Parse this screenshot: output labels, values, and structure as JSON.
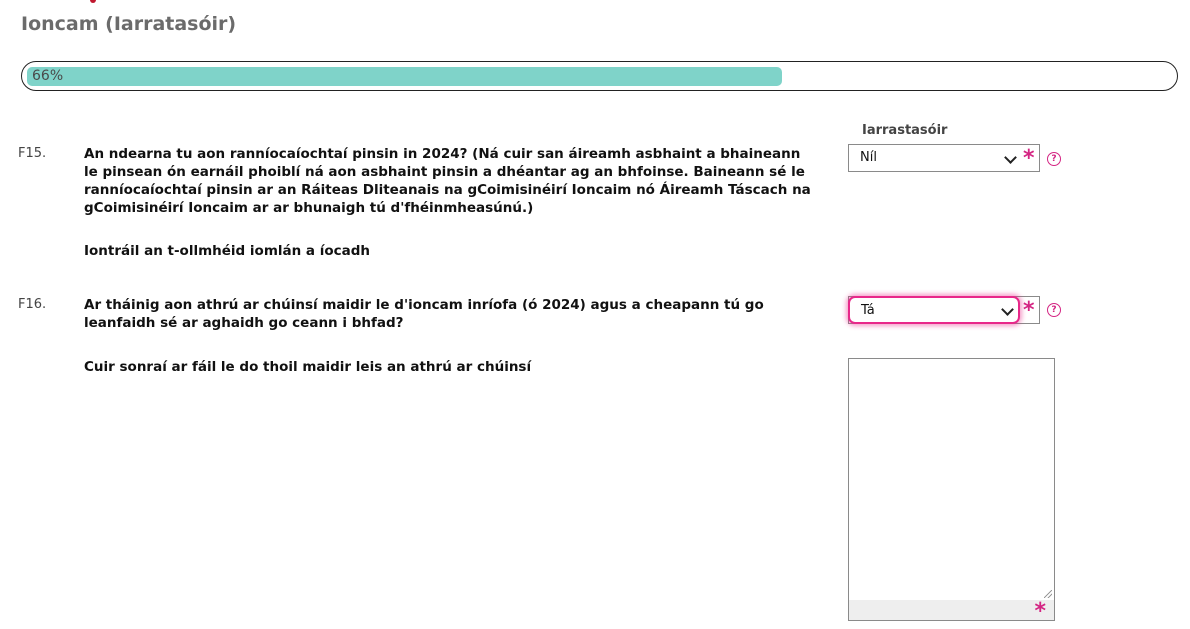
{
  "page": {
    "title": "Ioncam (Iarratasóir)"
  },
  "progress": {
    "label": "66%",
    "value": 0.66
  },
  "column_header": "Iarrastasóir",
  "questions": [
    {
      "number": "F15.",
      "text": "An ndearna tu aon ranníocaíochtaí pinsin in 2024? (Ná cuir san áireamh asbhaint a bhaineann le pinsean ón earnáil phoiblí ná aon asbhaint pinsin a dhéantar ag an bhfoinse. Baineann sé le ranníocaíochtaí pinsin ar an Ráiteas Dliteanais na gCoimisinéirí Ioncaim nó Áireamh Táscach na gCoimisinéirí Ioncaim ar ar bhunaigh tú d'fhéinmheasúnú.)",
      "answer": "Níl",
      "sub_label": "Iontráil an t-ollmhéid iomlán a íocadh"
    },
    {
      "number": "F16.",
      "text": "Ar tháinig aon athrú ar chúinsí maidir le d'ioncam inríofa (ó 2024) agus a cheapann tú go leanfaidh sé ar aghaidh go ceann i bhfad?",
      "answer": "Tá",
      "sub_label": "Cuir sonraí ar fáil le do thoil maidir leis an athrú ar chúinsí"
    }
  ],
  "required_marker": "*",
  "help_marker": "?",
  "colors": {
    "progress_fill": "#7fd3c9",
    "accent": "#d42583",
    "focus": "#e8288a"
  }
}
